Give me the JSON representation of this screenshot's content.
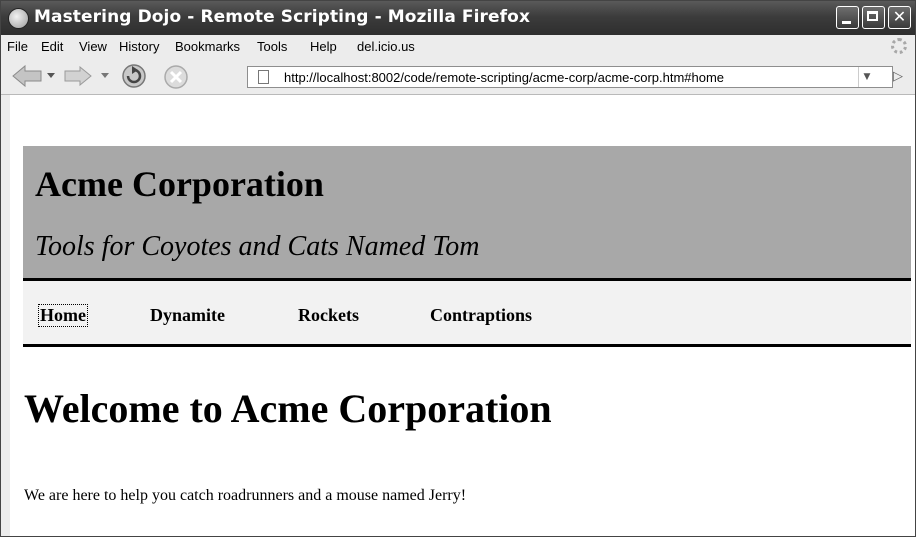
{
  "window": {
    "title": "Mastering Dojo - Remote Scripting - Mozilla Firefox"
  },
  "menu": {
    "items": [
      "File",
      "Edit",
      "View",
      "History",
      "Bookmarks",
      "Tools",
      "Help",
      "del.icio.us"
    ]
  },
  "toolbar": {
    "url": "http://localhost:8002/code/remote-scripting/acme-corp/acme-corp.htm#home"
  },
  "page": {
    "site_title": "Acme Corporation",
    "tagline": "Tools for Coyotes and Cats Named Tom",
    "nav": [
      "Home",
      "Dynamite",
      "Rockets",
      "Contraptions"
    ],
    "heading": "Welcome to Acme Corporation",
    "body": "We are here to help you catch roadrunners and a mouse named Jerry!"
  },
  "colors": {
    "banner_bg": "#a8a8a8",
    "nav_bg": "#f2f2f2",
    "titlebar_bg": "#3c3c3c"
  }
}
